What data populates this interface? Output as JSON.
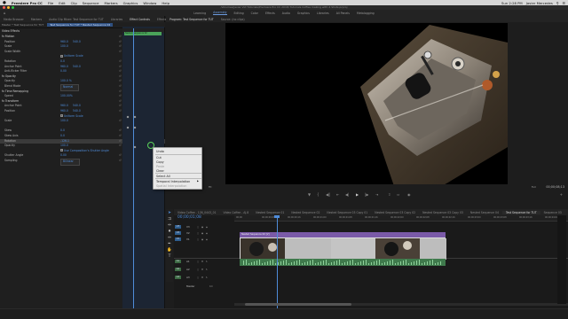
{
  "menubar": {
    "apple": "",
    "items": [
      "Premiere Pro CC",
      "File",
      "Edit",
      "Clip",
      "Sequence",
      "Markers",
      "Graphics",
      "Window",
      "Help"
    ],
    "clock": "Sun 2:28 PM",
    "user": "Javier Mercedes"
  },
  "titlebar": {
    "text": "/Volumes/Javier Vid Tutorials/Premiere Pro CC 2018/ Tutorials Coffee making with 4 Shots.prproj"
  },
  "workspaces": {
    "items": [
      "Learning",
      "Assembly",
      "Editing",
      "Color",
      "Effects",
      "Audio",
      "Graphics",
      "Libraries",
      "All Panels",
      "Metalogging"
    ],
    "active_index": 1
  },
  "effect_panel": {
    "tabs": [
      "Media Browser",
      "Markers",
      "Audio Clip Mixer: Test Sequence for TUT",
      "Libraries",
      "Effect Controls",
      "Effects"
    ],
    "active_tab": 4,
    "source": "Master * Test Sequence for TUT",
    "sequence_pill": "Test Sequence for TUT * Nested Sequence 02",
    "section_header": "Video Effects",
    "clip_label": "Nested Sequence 02",
    "rows": [
      {
        "name": "fx Motion",
        "v1": "",
        "v2": "",
        "grp": true
      },
      {
        "name": "Position",
        "v1": "960.0",
        "v2": "540.0"
      },
      {
        "name": "Scale",
        "v1": "100.0",
        "v2": ""
      },
      {
        "name": "Scale Width",
        "v1": "",
        "v2": ""
      },
      {
        "name": "",
        "v1": "Uniform Scale",
        "v2": "",
        "check": true
      },
      {
        "name": "Rotation",
        "v1": "0.0",
        "v2": ""
      },
      {
        "name": "Anchor Point",
        "v1": "960.0",
        "v2": "540.0"
      },
      {
        "name": "Anti-flicker Filter",
        "v1": "0.00",
        "v2": ""
      },
      {
        "name": "fx Opacity",
        "v1": "",
        "v2": "",
        "grp": true
      },
      {
        "name": "Opacity",
        "v1": "100.0 %",
        "v2": ""
      },
      {
        "name": "Blend Mode",
        "v1": "Normal",
        "v2": "",
        "dropdown": true
      },
      {
        "name": "fx Time Remapping",
        "v1": "",
        "v2": "",
        "grp": true
      },
      {
        "name": "Speed",
        "v1": "100.00%",
        "v2": ""
      },
      {
        "name": "fx Transform",
        "v1": "",
        "v2": "",
        "grp": true
      },
      {
        "name": "Anchor Point",
        "v1": "960.0",
        "v2": "540.0"
      },
      {
        "name": "Position",
        "v1": "960.0",
        "v2": "540.0"
      },
      {
        "name": "",
        "v1": "Uniform Scale",
        "v2": "",
        "check": true
      },
      {
        "name": "Scale",
        "v1": "100.0",
        "v2": ""
      },
      {
        "name": "",
        "v1": "",
        "v2": ""
      },
      {
        "name": "Skew",
        "v1": "0.0",
        "v2": ""
      },
      {
        "name": "Skew Axis",
        "v1": "0.0",
        "v2": ""
      },
      {
        "name": "Rotation",
        "v1": "-126.1",
        "v2": "",
        "sel": true
      },
      {
        "name": "Opacity",
        "v1": "100.0",
        "v2": ""
      },
      {
        "name": "",
        "v1": "Use Composition's Shutter Angle",
        "v2": "",
        "check": true
      },
      {
        "name": "Shutter Angle",
        "v1": "0.00",
        "v2": ""
      },
      {
        "name": "Sampling",
        "v1": "Bilinear",
        "v2": "",
        "dropdown": true
      }
    ]
  },
  "context_menu": {
    "items": [
      {
        "label": "Undo",
        "disabled": false
      },
      {
        "label": "Cut",
        "disabled": false
      },
      {
        "label": "Copy",
        "disabled": false
      },
      {
        "label": "Paste",
        "disabled": true
      },
      {
        "label": "Clear",
        "disabled": false
      },
      {
        "label": "Select All",
        "disabled": false
      },
      {
        "label": "Temporal Interpolation",
        "disabled": false,
        "submenu": true
      },
      {
        "label": "Spatial Interpolation",
        "disabled": true
      }
    ]
  },
  "program_monitor": {
    "tabs": [
      "Program: Test Sequence for TUT",
      "Source: (no clips)"
    ],
    "active_tab": 0,
    "timecode_left": "00;00;01;08",
    "fit": "Fit",
    "full": "Full",
    "timecode_right": "00;00;08;13",
    "controls": [
      "marker-icon",
      "in-point-icon",
      "out-point-icon",
      "go-to-in-icon",
      "step-back-icon",
      "play-icon",
      "step-forward-icon",
      "go-to-out-icon",
      "lift-icon",
      "extract-icon",
      "export-frame-icon"
    ]
  },
  "timeline": {
    "tabs": [
      "Video Coffee - 126_0443_01",
      "Video Coffee - AJ.8",
      "Nested Sequence 01",
      "Nested Sequence 02",
      "Nested Sequence 03 Copy 01",
      "Nested Sequence 03 Copy 02",
      "Nested Sequence 03 Copy 03",
      "Nested Sequence 04",
      "Test Sequence for TUT",
      "Sequence 03"
    ],
    "active_tab": 8,
    "timecode": "00;00;01;08",
    "ruler": [
      "00;00",
      "00;00;00;08",
      "00;00;00;16",
      "00;00;01;00",
      "00;00;01;08",
      "00;00;01;16",
      "00;00;02;00",
      "00;00;02;08",
      "00;00;02;16",
      "00;00;03;00",
      "00;00;03;08",
      "00;00;03;16",
      "00;00;04;00"
    ],
    "tracks": [
      {
        "name": "V3",
        "kind": "v"
      },
      {
        "name": "V2",
        "kind": "v"
      },
      {
        "name": "V1",
        "kind": "v"
      },
      {
        "name": "A1",
        "kind": "a"
      },
      {
        "name": "A2",
        "kind": "a"
      },
      {
        "name": "A3",
        "kind": "a"
      },
      {
        "name": "Master",
        "kind": "m"
      }
    ],
    "clip_label": "Nested Sequence 02 [V]",
    "master_value": "0.0"
  }
}
